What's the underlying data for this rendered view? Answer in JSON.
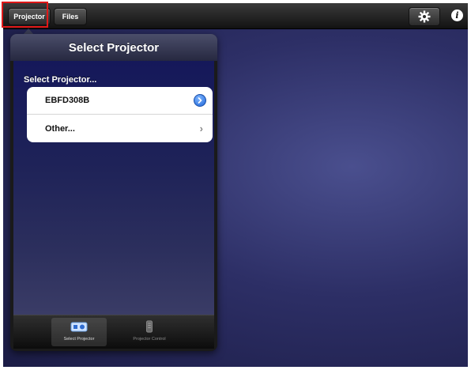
{
  "toolbar": {
    "projector_label": "Projector",
    "files_label": "Files",
    "settings_icon": "gear-icon",
    "info_icon": "info-icon",
    "info_glyph": "i"
  },
  "popover": {
    "title": "Select Projector",
    "section_label": "Select Projector...",
    "items": [
      {
        "label": "EBFD308B",
        "accessory": "detail-disclosure-icon"
      },
      {
        "label": "Other...",
        "accessory": "chevron-right-icon",
        "glyph": "›"
      }
    ],
    "tabs": [
      {
        "label": "Select Projector",
        "icon": "projector-icon",
        "selected": true
      },
      {
        "label": "Projector Control",
        "icon": "remote-control-icon",
        "selected": false
      }
    ]
  },
  "colors": {
    "highlight": "#e01818",
    "accent_blue": "#1f66d8",
    "background": "#2d2f66"
  }
}
